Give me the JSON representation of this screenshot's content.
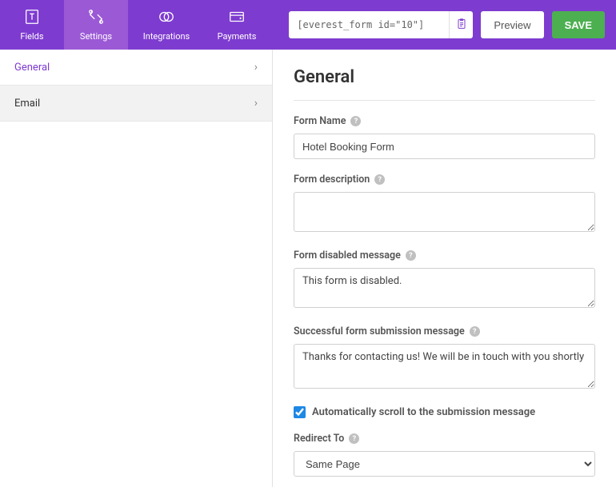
{
  "nav": {
    "fields": "Fields",
    "settings": "Settings",
    "integrations": "Integrations",
    "payments": "Payments"
  },
  "topbar": {
    "shortcode": "[everest_form id=\"10\"]",
    "preview": "Preview",
    "save": "SAVE"
  },
  "sidebar": {
    "general": "General",
    "email": "Email"
  },
  "main": {
    "heading": "General",
    "form_name_label": "Form Name",
    "form_name_value": "Hotel Booking Form",
    "form_desc_label": "Form description",
    "form_desc_value": "",
    "disabled_label": "Form disabled message",
    "disabled_value": "This form is disabled.",
    "success_label": "Successful form submission message",
    "success_value": "Thanks for contacting us! We will be in touch with you shortly",
    "autoscroll_label": "Automatically scroll to the submission message",
    "redirect_label": "Redirect To",
    "redirect_value": "Same Page"
  }
}
